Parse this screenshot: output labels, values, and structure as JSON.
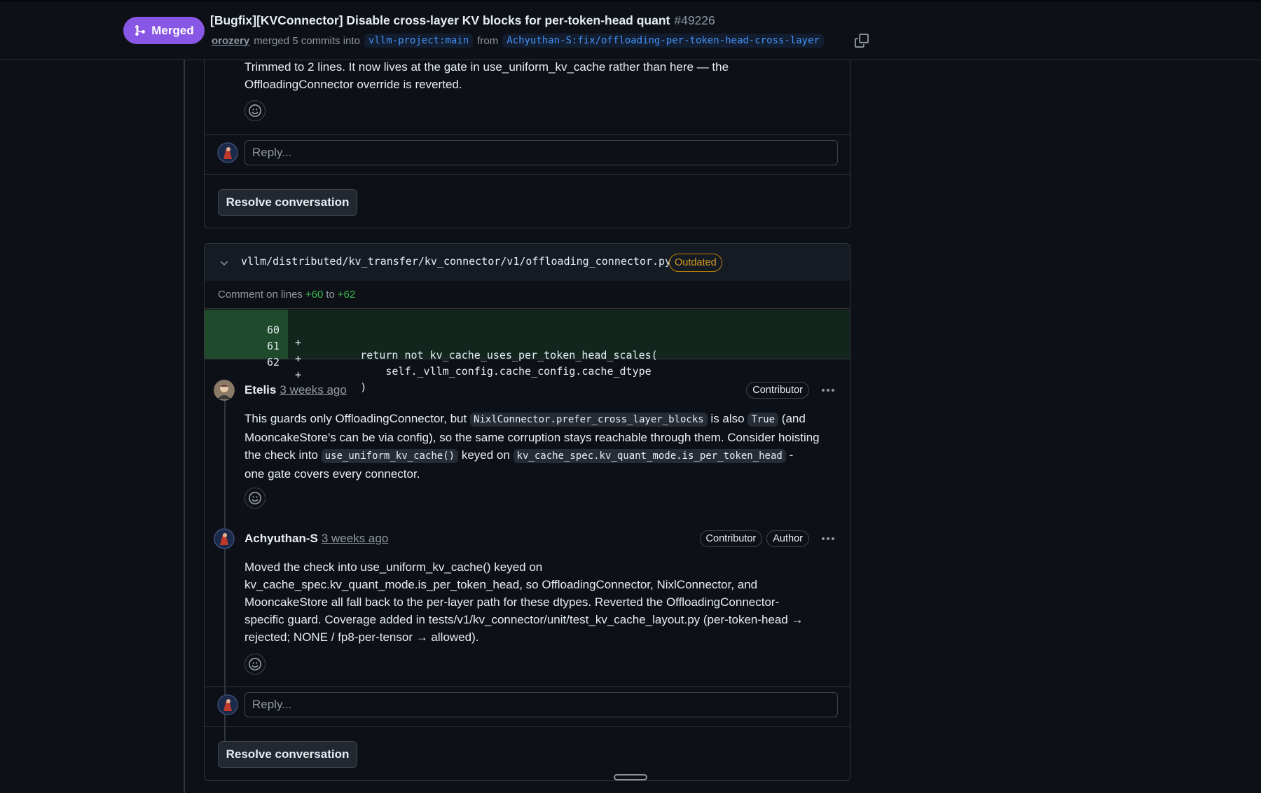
{
  "header": {
    "status": "Merged",
    "title": "[Bugfix][KVConnector] Disable cross-layer KV blocks for per-token-head quant",
    "number": "#49226",
    "author": "orozery",
    "merged_text": "merged 5 commits into",
    "base_branch": "vllm-project:main",
    "from_text": "from",
    "head_branch": "Achyuthan-S:fix/offloading-per-token-head-cross-layer"
  },
  "thread1": {
    "comment_text_1": "Trimmed to 2 lines. It now lives at the gate in use_uniform_kv_cache rather than here — the",
    "comment_text_2": "OffloadingConnector override is reverted.",
    "reply_placeholder": "Reply...",
    "resolve_label": "Resolve conversation"
  },
  "thread2": {
    "file_path": "vllm/distributed/kv_transfer/kv_connector/v1/offloading_connector.py",
    "outdated_label": "Outdated",
    "comment_on": "Comment on lines",
    "range_start": "+60",
    "range_to": "to",
    "range_end": "+62",
    "diff_lines": [
      {
        "num": "60",
        "sign": "+",
        "code": "        return not kv_cache_uses_per_token_head_scales("
      },
      {
        "num": "61",
        "sign": "+",
        "code": "            self._vllm_config.cache_config.cache_dtype"
      },
      {
        "num": "62",
        "sign": "+",
        "code": "        )"
      }
    ],
    "comments": [
      {
        "author": "Etelis",
        "time": "3 weeks ago",
        "badges": [
          "Contributor"
        ],
        "p1_a": "This guards only OffloadingConnector, but",
        "p1_code1": "NixlConnector.prefer_cross_layer_blocks",
        "p1_b": "is also",
        "p1_code2": "True",
        "p1_c": "(and",
        "p2": "MooncakeStore's can be via config), so the same corruption stays reachable through them. Consider hoisting",
        "p3_a": "the check into",
        "p3_code1": "use_uniform_kv_cache()",
        "p3_b": "keyed on",
        "p3_code2": "kv_cache_spec.kv_quant_mode.is_per_token_head",
        "p3_c": "-",
        "p4": "one gate covers every connector."
      },
      {
        "author": "Achyuthan-S",
        "time": "3 weeks ago",
        "badges": [
          "Contributor",
          "Author"
        ],
        "lines": [
          "Moved the check into use_uniform_kv_cache() keyed on",
          "kv_cache_spec.kv_quant_mode.is_per_token_head, so OffloadingConnector, NixlConnector, and",
          "MooncakeStore all fall back to the per-layer path for these dtypes. Reverted the OffloadingConnector-",
          "specific guard. Coverage added in tests/v1/kv_connector/unit/test_kv_cache_layout.py (per-token-head →",
          "rejected; NONE / fp8-per-tensor → allowed)."
        ]
      }
    ],
    "reply_placeholder": "Reply...",
    "resolve_label": "Resolve conversation"
  },
  "icons": {
    "merge": "git-merge-icon",
    "copy": "copy-icon",
    "smiley": "smiley-icon",
    "chevron": "chevron-down-icon",
    "kebab": "kebab-horizontal-icon"
  },
  "colors": {
    "merged_purple": "#8957e5",
    "added_green": "#3fb950",
    "outdated_orange": "#d29922",
    "link_blue": "#4493f8"
  }
}
